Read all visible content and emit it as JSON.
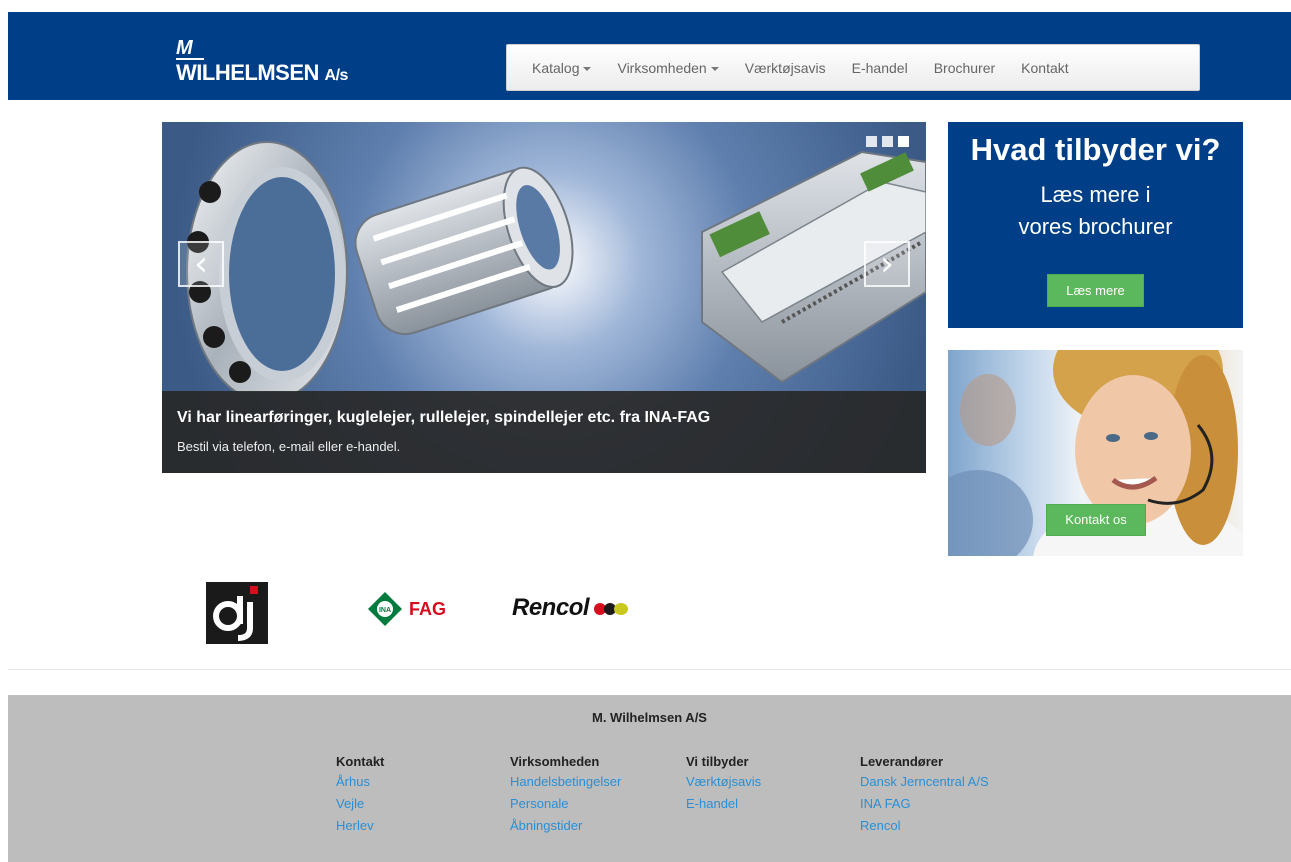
{
  "header": {
    "logo_top": "M",
    "logo_name": "WILHELMSEN",
    "logo_suffix": "A/s",
    "bg_color": "#003f87"
  },
  "nav": {
    "items": [
      {
        "label": "Katalog",
        "dropdown": true
      },
      {
        "label": "Virksomheden",
        "dropdown": true
      },
      {
        "label": "Værktøjsavis",
        "dropdown": false
      },
      {
        "label": "E-handel",
        "dropdown": false
      },
      {
        "label": "Brochurer",
        "dropdown": false
      },
      {
        "label": "Kontakt",
        "dropdown": false
      }
    ]
  },
  "carousel": {
    "title": "Vi har linearføringer, kuglelejer, rullelejer, spindellejer etc. fra INA-FAG",
    "subtitle": "Bestil via telefon, e-mail eller e-handel.",
    "prev_glyph": "‹",
    "next_glyph": "›",
    "slide_count": 3,
    "active_slide": 3
  },
  "promo_brochure": {
    "heading": "Hvad tilbyder vi?",
    "line1": "Læs mere i",
    "line2": "vores brochurer",
    "button": "Læs mere"
  },
  "promo_contact": {
    "button": "Kontakt os"
  },
  "brands": {
    "fag": "FAG",
    "ina": "INA",
    "rencol": "Rencol"
  },
  "footer": {
    "title": "M. Wilhelmsen A/S",
    "columns": [
      {
        "heading": "Kontakt",
        "links": [
          "Århus",
          "Vejle",
          "Herlev"
        ]
      },
      {
        "heading": "Virksomheden",
        "links": [
          "Handelsbetingelser",
          "Personale",
          "Åbningstider"
        ]
      },
      {
        "heading": "Vi tilbyder",
        "links": [
          "Værktøjsavis",
          "E-handel"
        ]
      },
      {
        "heading": "Leverandører",
        "links": [
          "Dansk Jerncentral A/S",
          "INA FAG",
          "Rencol"
        ]
      }
    ]
  },
  "colors": {
    "brand_blue": "#003f87",
    "button_green": "#5cb85c",
    "link_blue": "#2a8fd4",
    "footer_bg": "#bdbdbd"
  }
}
